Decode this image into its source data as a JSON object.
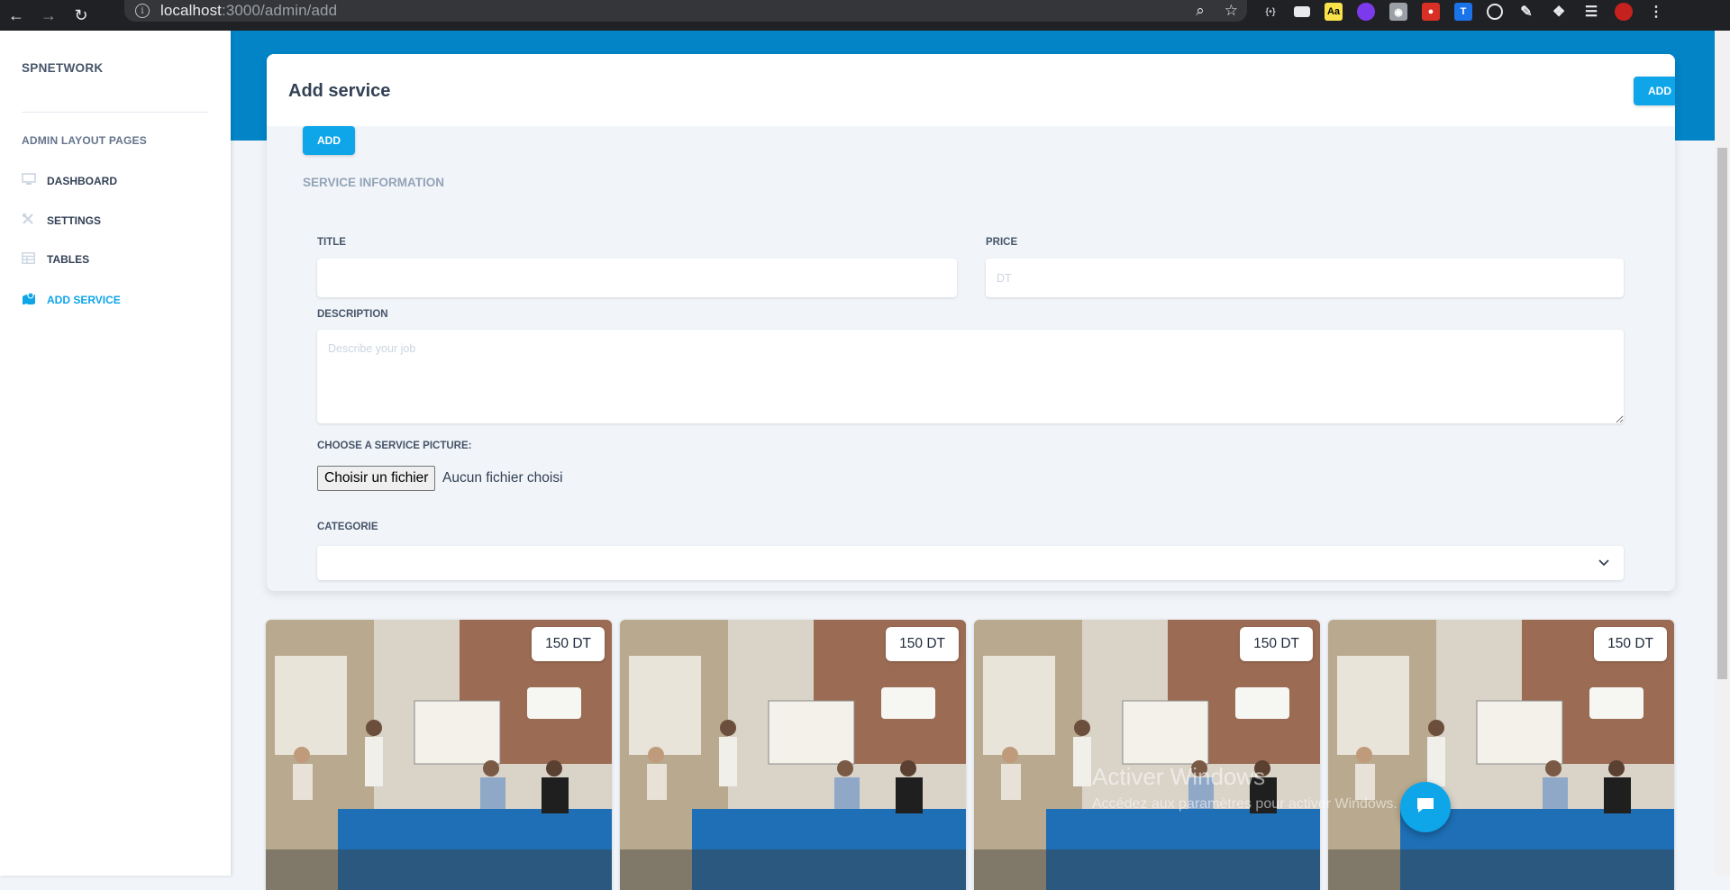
{
  "browser": {
    "url_host": "localhost",
    "url_rest": ":3000/admin/add"
  },
  "sidebar": {
    "brand": "SPNETWORK",
    "section_title": "ADMIN LAYOUT PAGES",
    "items": [
      {
        "label": "DASHBOARD",
        "icon": "monitor-icon",
        "active": false
      },
      {
        "label": "SETTINGS",
        "icon": "tools-icon",
        "active": false
      },
      {
        "label": "TABLES",
        "icon": "table-icon",
        "active": false
      },
      {
        "label": "ADD SERVICE",
        "icon": "map-icon",
        "active": true
      }
    ]
  },
  "card": {
    "title": "Add service",
    "add_top_label": "ADD",
    "add_inner_label": "ADD",
    "section_label": "SERVICE INFORMATION"
  },
  "form": {
    "title_label": "TITLE",
    "title_value": "",
    "price_label": "PRICE",
    "price_placeholder": "DT",
    "description_label": "DESCRIPTION",
    "description_placeholder": "Describe your job",
    "picture_label": "CHOOSE A SERVICE PICTURE:",
    "file_button": "Choisir un fichier",
    "file_status": "Aucun fichier choisi",
    "category_label": "CATEGORIE",
    "category_value": ""
  },
  "services": [
    {
      "price": "150 DT"
    },
    {
      "price": "150 DT"
    },
    {
      "price": "150 DT"
    },
    {
      "price": "150 DT"
    }
  ],
  "watermark": {
    "title": "Activer Windows",
    "subtitle": "Accédez aux paramètres pour activer Windows."
  },
  "colors": {
    "accent": "#0ea5e9",
    "header_blue": "#0284c7",
    "chrome_dark": "#202124"
  }
}
